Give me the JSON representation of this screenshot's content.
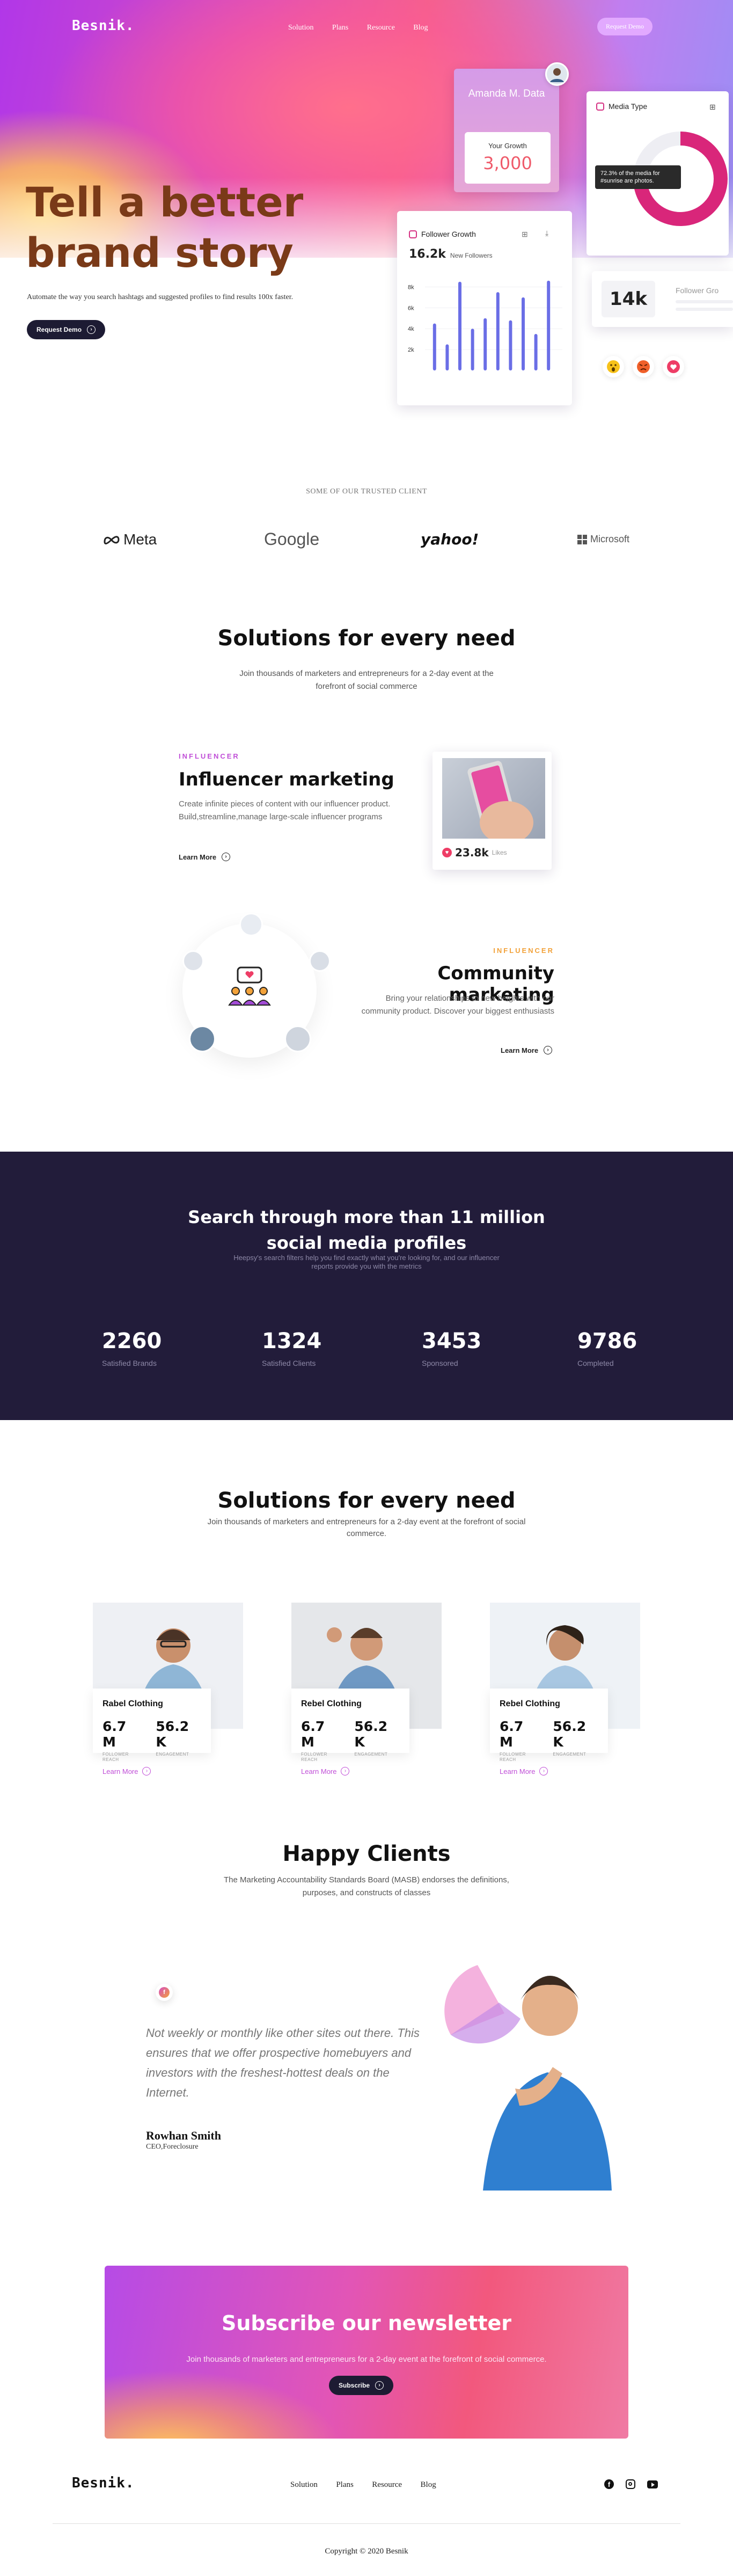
{
  "header": {
    "logo": "Besnik.",
    "nav": [
      "Solution",
      "Plans",
      "Resource",
      "Blog"
    ],
    "cta": "Request Demo"
  },
  "hero": {
    "title_line1": "Tell a better",
    "title_line2": "brand story",
    "subtitle": "Automate the way you search hashtags and suggested profiles to find results 100x faster.",
    "button": "Request Demo",
    "profile_card": {
      "name": "Amanda M. Data",
      "growth_label": "Your Growth",
      "growth_value": "3,000"
    },
    "media_card": {
      "title": "Media Type",
      "tooltip": "72.3% of the media for #sunrise are photos.",
      "donut_percent": 72.3
    },
    "follower_card": {
      "title": "Follower Growth",
      "value": "16.2k",
      "value_label": "New Followers",
      "y_ticks": [
        "8k",
        "6k",
        "4k",
        "2k"
      ]
    },
    "k_card": {
      "value": "14k",
      "label": "Follower Gro"
    }
  },
  "chart_data": {
    "type": "bar",
    "values": [
      4.5,
      2.5,
      8.5,
      4.0,
      5.0,
      7.5,
      4.8,
      7.0,
      3.5,
      8.6
    ],
    "ylim": [
      0,
      9
    ],
    "y_ticks": [
      "8k",
      "6k",
      "4k",
      "2k"
    ]
  },
  "trusted": {
    "title": "SOME OF OUR TRUSTED CLIENT",
    "brands": [
      "Meta",
      "Google",
      "yahoo!",
      "Microsoft"
    ]
  },
  "solutions": {
    "title": "Solutions for every need",
    "subtitle": "Join thousands of marketers and entrepreneurs for a 2-day event at the forefront of social commerce",
    "influencer": {
      "tag": "INFLUENCER",
      "title": "Influencer marketing",
      "text": "Create infinite pieces of content with our influencer product. Build,streamline,manage large-scale influencer programs",
      "link": "Learn More",
      "likes": "23.8k",
      "likes_label": "Likes"
    },
    "community": {
      "tag": "INFLUENCER",
      "title": "Community marketing",
      "text": "Bring your relationships to new heights with our community product. Discover your biggest enthusiasts",
      "link": "Learn More"
    }
  },
  "stats": {
    "title": "Search through more than 11 million social media profiles",
    "subtitle": "Heepsy's search filters help you find exactly what you're looking for, and our influencer reports provide you with the metrics",
    "items": [
      {
        "value": "2260",
        "label": "Satisfied Brands"
      },
      {
        "value": "1324",
        "label": "Satisfied Clients"
      },
      {
        "value": "3453",
        "label": "Sponsored"
      },
      {
        "value": "9786",
        "label": "Completed"
      }
    ]
  },
  "profiles": {
    "title": "Solutions for every need",
    "subtitle": "Join thousands of marketers and entrepreneurs for a 2-day event at the forefront of social commerce.",
    "cards": [
      {
        "name": "Rabel Clothing",
        "stat1": "6.7 M",
        "stat1_label": "FOLLOWER REACH",
        "stat2": "56.2 K",
        "stat2_label": "ENGAGEMENT",
        "link": "Learn More"
      },
      {
        "name": "Rebel Clothing",
        "stat1": "6.7 M",
        "stat1_label": "FOLLOWER REACH",
        "stat2": "56.2 K",
        "stat2_label": "ENGAGEMENT",
        "link": "Learn More"
      },
      {
        "name": "Rebel Clothing",
        "stat1": "6.7 M",
        "stat1_label": "FOLLOWER REACH",
        "stat2": "56.2 K",
        "stat2_label": "ENGAGEMENT",
        "link": "Learn More"
      }
    ]
  },
  "testimonials": {
    "title": "Happy Clients",
    "subtitle": "The Marketing Accountability Standards Board (MASB) endorses the definitions, purposes, and constructs of classes",
    "quote": "Not weekly or monthly like other sites out there. This ensures that we offer prospective homebuyers and investors with the freshest-hottest deals on the Internet.",
    "author": "Rowhan Smith",
    "role": "CEO,Foreclosure"
  },
  "newsletter": {
    "title": "Subscribe our newsletter",
    "subtitle": "Join thousands of marketers and entrepreneurs for a 2-day event at the forefront of social commerce.",
    "button": "Subscribe"
  },
  "footer": {
    "logo": "Besnik.",
    "nav": [
      "Solution",
      "Plans",
      "Resource",
      "Blog"
    ],
    "copyright": "Copyright © 2020 Besnik"
  },
  "colors": {
    "accent_purple": "#b137e8",
    "accent_pink": "#e8326f",
    "dark": "#221c3a",
    "chart_bar": "#6a6ee6"
  }
}
